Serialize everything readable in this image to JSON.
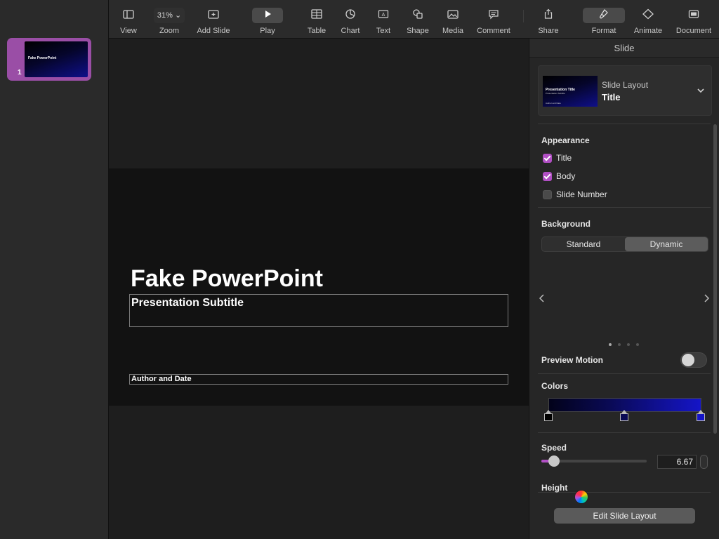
{
  "toolbar": {
    "view": "View",
    "zoom_value": "31%",
    "zoom": "Zoom",
    "add_slide": "Add Slide",
    "play": "Play",
    "table": "Table",
    "chart": "Chart",
    "text": "Text",
    "shape": "Shape",
    "media": "Media",
    "comment": "Comment",
    "share": "Share",
    "format": "Format",
    "animate": "Animate",
    "document": "Document"
  },
  "navigator": {
    "slides": [
      {
        "number": "1",
        "title": "Fake PowerPoint"
      }
    ]
  },
  "slide": {
    "title": "Fake PowerPoint",
    "subtitle": "Presentation Subtitle",
    "author": "Author and Date"
  },
  "inspector": {
    "header": "Slide",
    "layout_label": "Slide Layout",
    "layout_name": "Title",
    "layout_thumb_title": "Presentation Title",
    "layout_thumb_subtitle": "Presentation Subtitle",
    "layout_thumb_author": "Author and Date",
    "appearance_title": "Appearance",
    "appearance": [
      {
        "label": "Title",
        "checked": true
      },
      {
        "label": "Body",
        "checked": true
      },
      {
        "label": "Slide Number",
        "checked": false
      }
    ],
    "background_title": "Background",
    "background_options": [
      "Standard",
      "Dynamic"
    ],
    "background_selected": "Dynamic",
    "preview_motion": "Preview Motion",
    "preview_motion_on": false,
    "colors_title": "Colors",
    "color_stops": [
      "#000000",
      "#0a0a55",
      "#1515c8"
    ],
    "speed_title": "Speed",
    "speed_value": "6.67",
    "speed_fraction": 0.12,
    "height_title": "Height",
    "edit_layout": "Edit Slide Layout",
    "page_count": 4,
    "page_current": 0
  },
  "colors": {
    "accent": "#b14fc4",
    "panel": "#262626"
  }
}
